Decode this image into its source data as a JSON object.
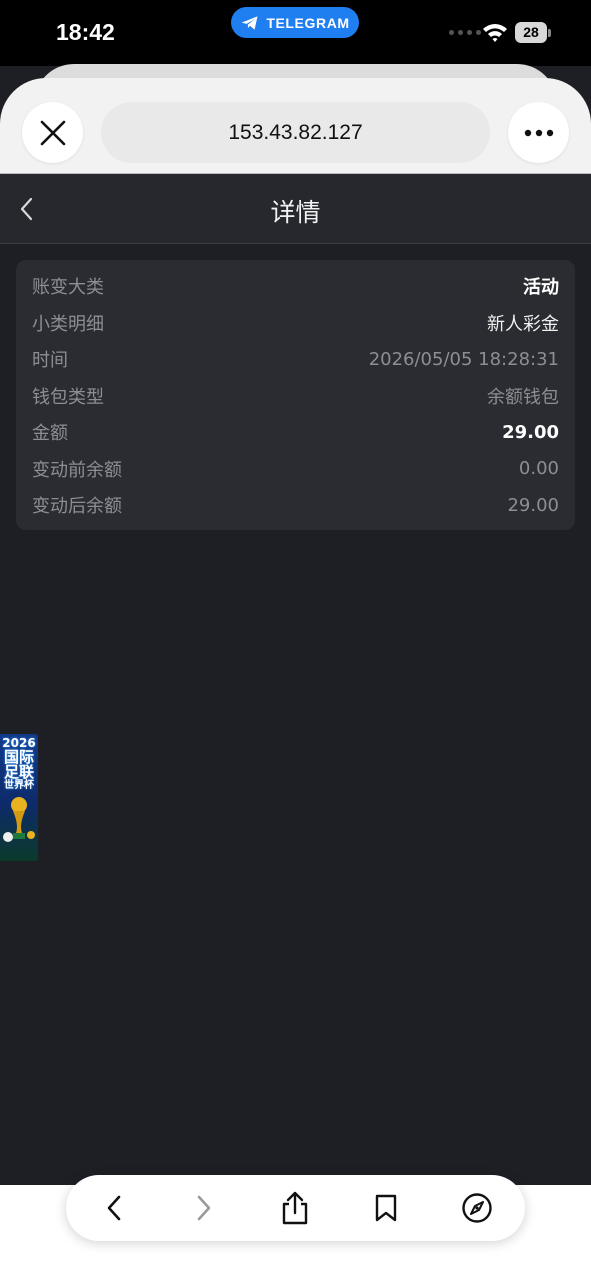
{
  "status_bar": {
    "time": "18:42",
    "telegram_label": "TELEGRAM",
    "battery": "28"
  },
  "browser": {
    "url": "153.43.82.127"
  },
  "page": {
    "title": "详情",
    "details": [
      {
        "label": "账变大类",
        "value": "活动"
      },
      {
        "label": "小类明细",
        "value": "新人彩金"
      },
      {
        "label": "时间",
        "value": "2026/05/05 18:28:31"
      },
      {
        "label": "钱包类型",
        "value": "余额钱包"
      },
      {
        "label": "金额",
        "value": "29.00"
      },
      {
        "label": "变动前余额",
        "value": "0.00"
      },
      {
        "label": "变动后余额",
        "value": "29.00"
      }
    ]
  },
  "banner": {
    "year": "2026",
    "line1": "国际",
    "line2": "足联",
    "line3": "世界杯"
  },
  "icons": {
    "telegram": "telegram-plane-icon",
    "close": "close-icon",
    "more": "more-icon",
    "back": "chevron-left-icon",
    "forward": "chevron-right-icon",
    "share": "share-icon",
    "bookmark": "bookmark-icon",
    "compass": "compass-icon"
  },
  "colors": {
    "page_background": "#1e1f24",
    "card_background": "#2b2c31",
    "telegram_blue": "#1f7ff0"
  }
}
